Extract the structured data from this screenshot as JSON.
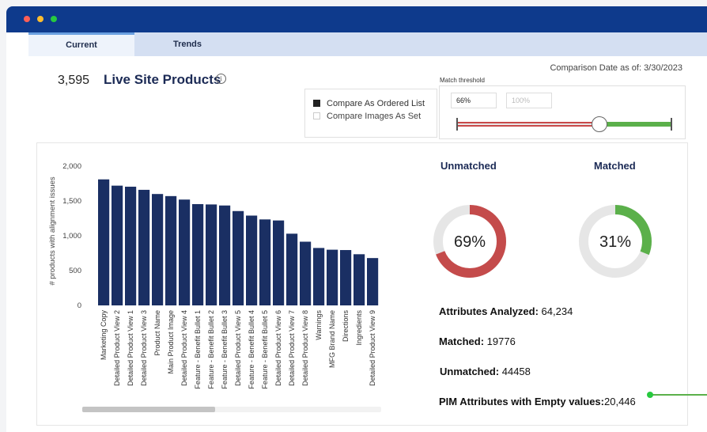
{
  "tabs": [
    {
      "label": "Current"
    },
    {
      "label": "Trends"
    }
  ],
  "header": {
    "count": "3,595",
    "title": "Live Site Products",
    "comparison_date": "Comparison Date as of: 3/30/2023"
  },
  "compare_options": [
    {
      "label": "Compare As Ordered List",
      "checked": true
    },
    {
      "label": "Compare Images As Set",
      "checked": false
    }
  ],
  "threshold": {
    "label": "Match threshold",
    "value": "66%",
    "max_placeholder": "100%",
    "slider_percent": 66
  },
  "chart_data": {
    "type": "bar",
    "ylabel": "# products with alignment issues",
    "ylim": [
      0,
      2000
    ],
    "yticks": [
      "0",
      "500",
      "1,000",
      "1,500",
      "2,000"
    ],
    "categories": [
      "Marketing Copy",
      "Detailed Product View 2",
      "Detailed Product View 1",
      "Detailed Product View 3",
      "Product Name",
      "Main Product Image",
      "Detailed Product View 4",
      "Feature - Benefit Bullet 1",
      "Feature - Benefit Bullet 2",
      "Feature - Benefit Bullet 3",
      "Detailed Product View 5",
      "Feature - Benefit Bullet 4",
      "Feature - Benefit Bullet 5",
      "Detailed Product View 6",
      "Detailed Product View 7",
      "Detailed Product View 8",
      "Warnings",
      "MFG Brand Name",
      "Directions",
      "Ingredients",
      "Detailed Product View 9"
    ],
    "values": [
      1810,
      1720,
      1705,
      1660,
      1600,
      1570,
      1520,
      1455,
      1450,
      1435,
      1355,
      1290,
      1235,
      1220,
      1030,
      915,
      825,
      800,
      795,
      735,
      680
    ],
    "color": "#1a2f63"
  },
  "donuts": {
    "unmatched": {
      "title": "Unmatched",
      "label": "69%",
      "percent": 69,
      "color": "#c44b4b"
    },
    "matched": {
      "title": "Matched",
      "label": "31%",
      "percent": 31,
      "color": "#5bb04a"
    },
    "track_color": "#e6e6e6"
  },
  "stats": {
    "analyzed_label": "Attributes Analyzed:",
    "analyzed_value": " 64,234",
    "matched_label": "Matched:",
    "matched_value": " 19776",
    "unmatched_label": "Unmatched:",
    "unmatched_value": " 44458",
    "empty_label": "PIM Attributes with Empty values:",
    "empty_value": "20,446"
  }
}
